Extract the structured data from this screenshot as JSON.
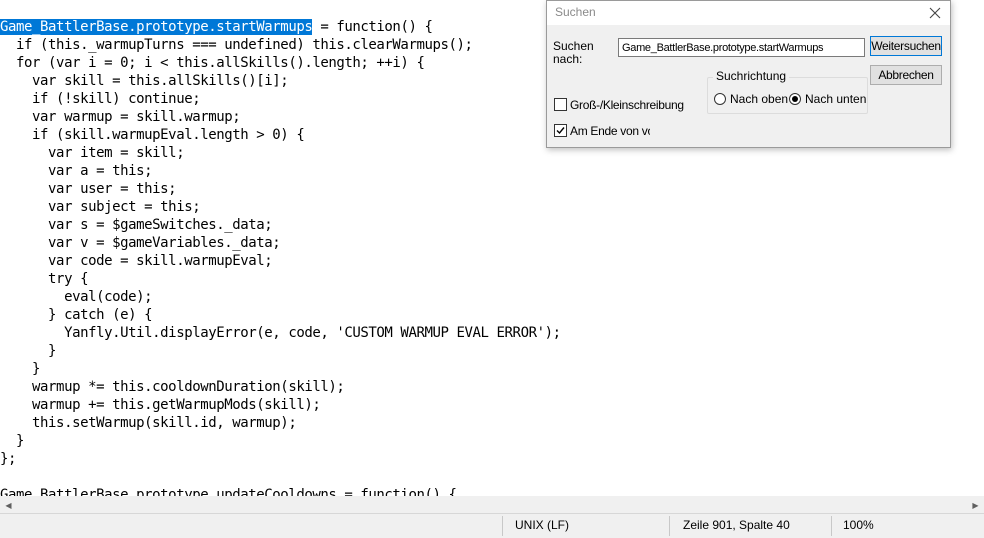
{
  "editor": {
    "selected_text": "Game_BattlerBase.prototype.startWarmups",
    "lines": [
      " = function() {",
      "  if (this._warmupTurns === undefined) this.clearWarmups();",
      "  for (var i = 0; i < this.allSkills().length; ++i) {",
      "    var skill = this.allSkills()[i];",
      "    if (!skill) continue;",
      "    var warmup = skill.warmup;",
      "    if (skill.warmupEval.length > 0) {",
      "      var item = skill;",
      "      var a = this;",
      "      var user = this;",
      "      var subject = this;",
      "      var s = $gameSwitches._data;",
      "      var v = $gameVariables._data;",
      "      var code = skill.warmupEval;",
      "      try {",
      "        eval(code);",
      "      } catch (e) {",
      "        Yanfly.Util.displayError(e, code, 'CUSTOM WARMUP EVAL ERROR');",
      "      }",
      "    }",
      "    warmup *= this.cooldownDuration(skill);",
      "    warmup += this.getWarmupMods(skill);",
      "    this.setWarmup(skill.id, warmup);",
      "  }",
      "};",
      "",
      "Game_BattlerBase.prototype.updateCooldowns = function() {"
    ]
  },
  "find_dialog": {
    "title": "Suchen",
    "search_label": "Suchen\nnach:",
    "search_value": "Game_BattlerBase.prototype.startWarmups",
    "find_next_label": "Weitersuchen",
    "cancel_label": "Abbrechen",
    "direction_label": "Suchrichtung",
    "direction_up_label": "Nach oben",
    "direction_down_label": "Nach unten",
    "direction_selected": "down",
    "match_case_label": "Groß-/Kleinschreibung",
    "match_case_checked": false,
    "wrap_label": "Am Ende von vor",
    "wrap_checked": true
  },
  "statusbar": {
    "line_ending": "UNIX (LF)",
    "position": "Zeile 901, Spalte 40",
    "zoom": "100%"
  }
}
